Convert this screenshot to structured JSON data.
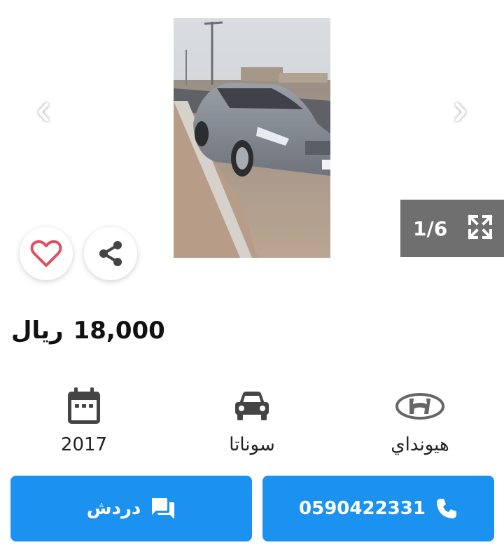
{
  "gallery": {
    "counter": "1/6",
    "icons": {
      "prev": "chevron-left-icon",
      "next": "chevron-right-icon",
      "fullscreen": "expand-icon",
      "favorite": "heart-icon",
      "share": "share-icon"
    }
  },
  "listing": {
    "price": "18,000",
    "currency": "ريال"
  },
  "specs": {
    "year": "2017",
    "model": "سوناتا",
    "make": "هيونداي"
  },
  "actions": {
    "chat_label": "دردش",
    "phone": "0590422331"
  },
  "colors": {
    "accent": "#1c92f0",
    "overlay": "#6f6f6f",
    "heart": "#e04f5f",
    "icon_dark": "#444444"
  }
}
